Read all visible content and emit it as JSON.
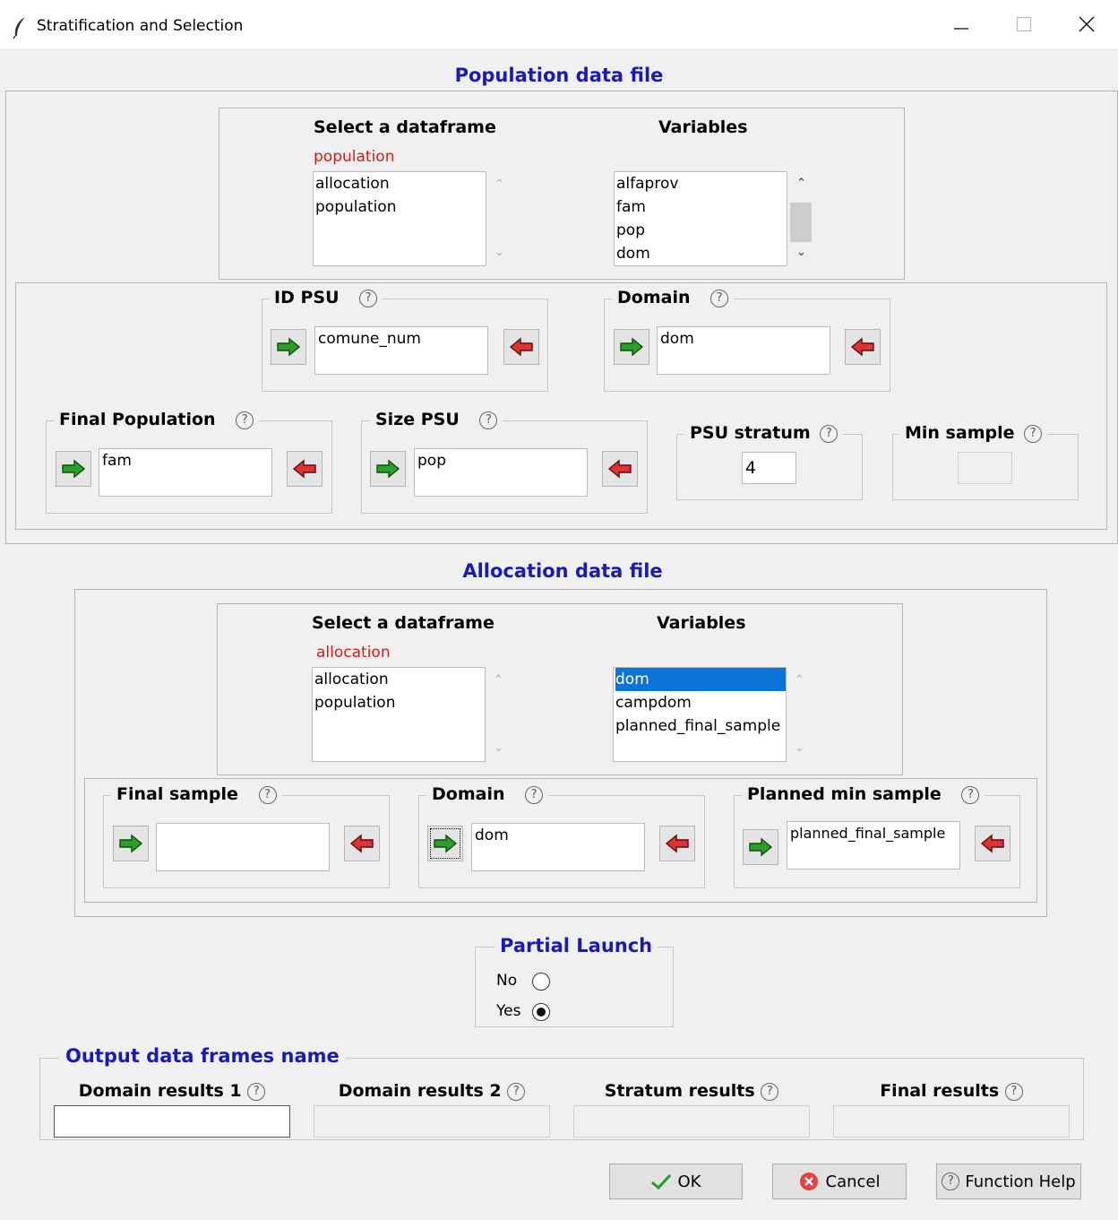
{
  "window": {
    "title": "Stratification and Selection"
  },
  "population": {
    "heading": "Population data file",
    "select_label": "Select a dataframe",
    "variables_label": "Variables",
    "selected_df": "population",
    "dataframes": [
      "allocation",
      "population"
    ],
    "variables": [
      "alfaprov",
      "fam",
      "pop",
      "dom"
    ],
    "id_psu": {
      "label": "ID PSU",
      "value": "comune_num"
    },
    "domain": {
      "label": "Domain",
      "value": "dom"
    },
    "final_population": {
      "label": "Final Population",
      "value": "fam"
    },
    "size_psu": {
      "label": "Size PSU",
      "value": "pop"
    },
    "psu_stratum": {
      "label": "PSU stratum",
      "value": "4"
    },
    "min_sample": {
      "label": "Min sample",
      "value": ""
    }
  },
  "allocation": {
    "heading": "Allocation data file",
    "select_label": "Select a dataframe",
    "variables_label": "Variables",
    "selected_df": "allocation",
    "dataframes": [
      "allocation",
      "population"
    ],
    "variables": [
      "dom",
      "campdom",
      "planned_final_sample"
    ],
    "selected_variable": "dom",
    "final_sample": {
      "label": "Final sample",
      "value": ""
    },
    "domain": {
      "label": "Domain",
      "value": "dom"
    },
    "planned_min_sample": {
      "label": "Planned min sample",
      "value": "planned_final_sample"
    }
  },
  "partial_launch": {
    "heading": "Partial Launch",
    "options": [
      "No",
      "Yes"
    ],
    "selected": "Yes"
  },
  "output": {
    "heading": "Output data frames name",
    "fields": [
      {
        "label": "Domain results 1",
        "value": ""
      },
      {
        "label": "Domain results 2",
        "value": ""
      },
      {
        "label": "Stratum results",
        "value": ""
      },
      {
        "label": "Final results",
        "value": ""
      }
    ]
  },
  "buttons": {
    "ok": "OK",
    "cancel": "Cancel",
    "help": "Function Help"
  },
  "icons": {
    "help": "?",
    "add": "green-right-arrow-icon",
    "remove": "red-left-arrow-icon"
  },
  "colors": {
    "heading": "#1a1ab5",
    "selected_df": "#d51b1b",
    "selection": "#0a74d8"
  }
}
